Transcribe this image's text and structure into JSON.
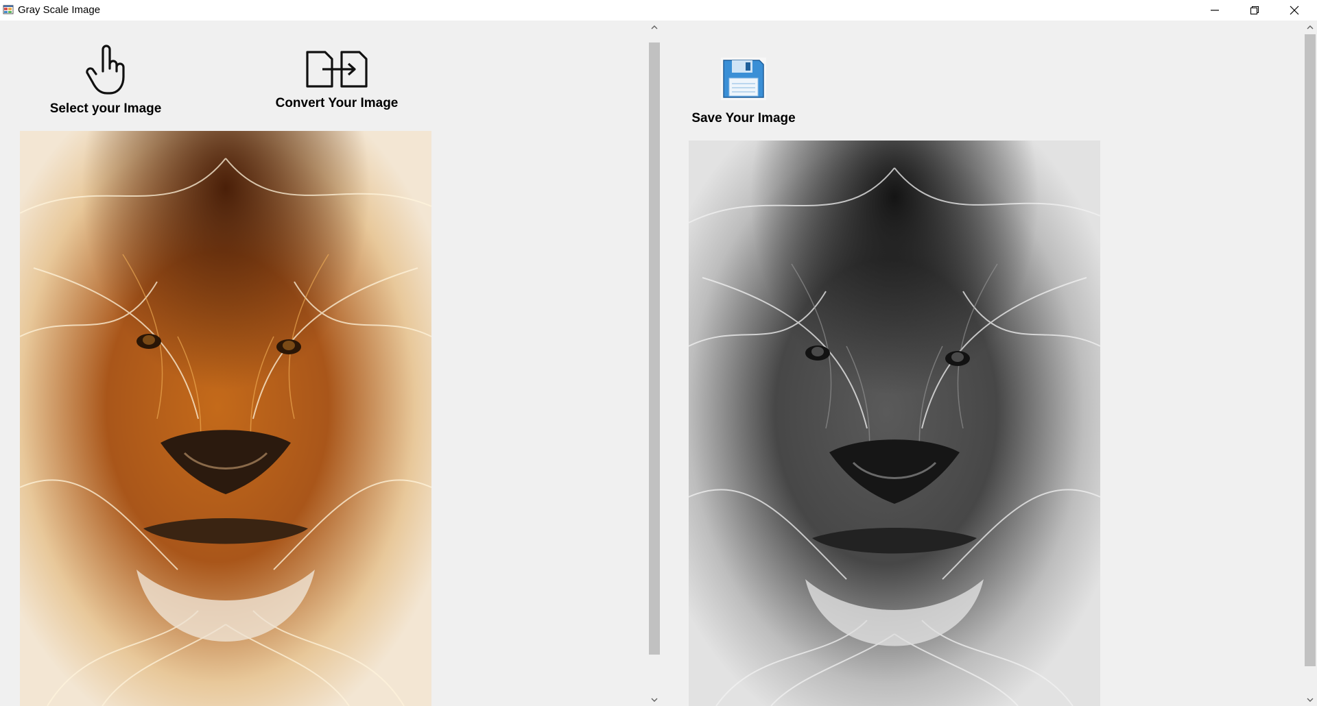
{
  "window": {
    "title": "Gray Scale Image",
    "icons": {
      "app": "app-window-icon",
      "minimize": "minimize-icon",
      "restore": "restore-icon",
      "close": "close-icon"
    }
  },
  "toolbar_left": {
    "select_label": "Select your Image",
    "select_icon": "pointing-hand-icon",
    "convert_label": "Convert Your Image",
    "convert_icon": "convert-files-icon"
  },
  "toolbar_right": {
    "save_label": "Save Your Image",
    "save_icon": "floppy-disk-icon"
  },
  "images": {
    "original": {
      "subject": "lion",
      "style": "color",
      "tone": "#b5651d"
    },
    "converted": {
      "subject": "lion",
      "style": "grayscale",
      "tone": "#6e6e6e"
    }
  },
  "colors": {
    "window_bg": "#f0f0f0",
    "scrollbar_thumb": "#c1c1c1",
    "floppy_blue": "#3a8fd6"
  }
}
